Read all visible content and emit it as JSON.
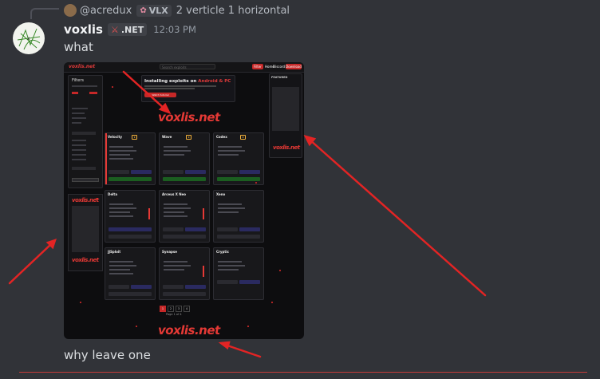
{
  "reply": {
    "username": "@acredux",
    "tag": "VLX",
    "text": "2 verticle 1 horizontal"
  },
  "message": {
    "author": "voxlis",
    "server_tag": ".NET",
    "time": "12:03 PM",
    "text_top": "what",
    "text_bottom": "why leave one"
  },
  "screenshot": {
    "site_logo": "voxlis.net",
    "search_placeholder": "Search exploits",
    "topbar_buttons": [
      "Filter",
      "Home",
      "Discord",
      "Download"
    ],
    "filters_title": "Filters",
    "hero_title_prefix": "Installing exploits on ",
    "hero_title_accent": "Android & PC",
    "hero_button": "Watch tutorial",
    "featured_label": "FEATURED",
    "cards": [
      "Velocity",
      "Wave",
      "Codex",
      "Delta",
      "Arceus X Neo",
      "Xeno",
      "JJSploit",
      "Synapse",
      "Cryptic"
    ],
    "page_numbers": [
      "1",
      "2",
      "3",
      "4"
    ],
    "page_label": "Page 1 of 4"
  },
  "colors": {
    "background": "#313338",
    "accent_red": "#e53935",
    "arrow_red": "#e32424"
  }
}
